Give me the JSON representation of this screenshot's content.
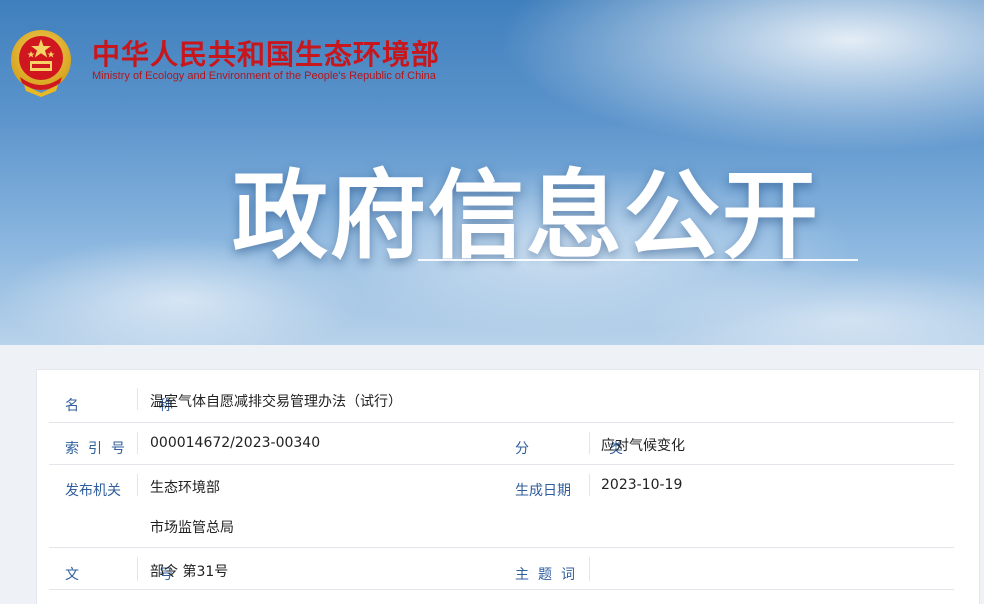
{
  "header": {
    "org_name_cn": "中华人民共和国生态环境部",
    "org_name_en": "Ministry of Ecology and Environment of the People's Republic of China",
    "emblem_icon": "national-emblem-icon",
    "hero_title": "政府信息公开"
  },
  "colors": {
    "brand_red": "#c8161d",
    "label_blue": "#2f5e9c"
  },
  "info": {
    "name_label": "名　称",
    "name_value": "温室气体自愿减排交易管理办法（试行）",
    "index_label": "索引号",
    "index_value": "000014672/2023-00340",
    "category_label": "分　类",
    "category_value": "应对气候变化",
    "issuer_label": "发布机关",
    "issuer_values": [
      "生态环境部",
      "市场监管总局"
    ],
    "date_label": "生成日期",
    "date_value": "2023-10-19",
    "doc_no_label": "文　号",
    "doc_no_value": "部令 第31号",
    "keywords_label": "主题词",
    "keywords_value": ""
  }
}
